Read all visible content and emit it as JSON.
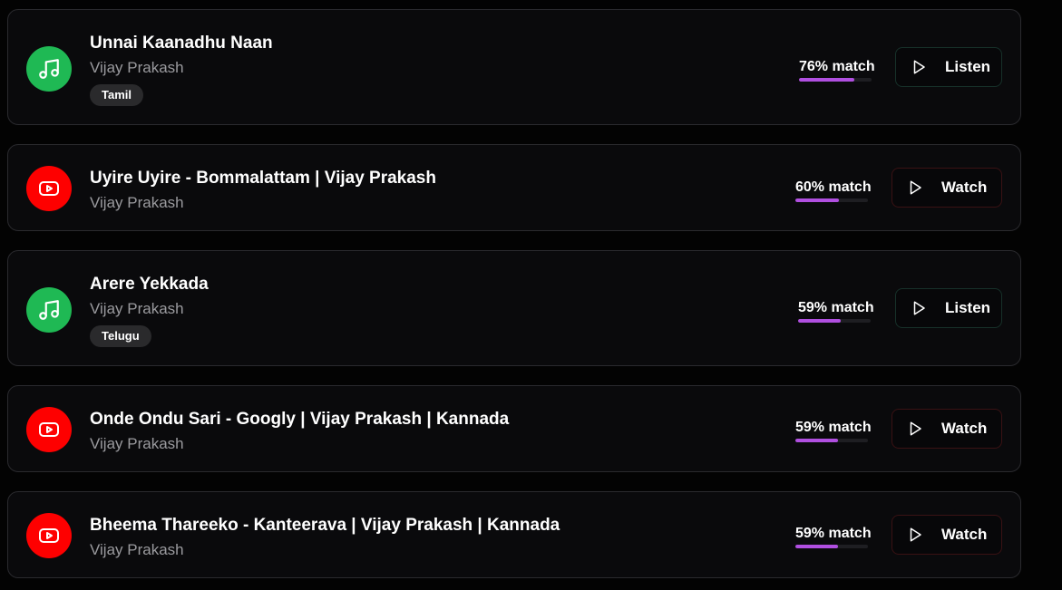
{
  "results": [
    {
      "title": "Unnai Kaanadhu Naan",
      "artist": "Vijay Prakash",
      "language": "Tamil",
      "source": "music",
      "source_icon": "music-note-icon",
      "match_label": "76% match",
      "match_fraction": 0.76,
      "action_label": "Listen"
    },
    {
      "title": "Uyire Uyire - Bommalattam | Vijay Prakash",
      "artist": "Vijay Prakash",
      "source": "youtube",
      "source_icon": "youtube-icon",
      "match_label": "60% match",
      "match_fraction": 0.6,
      "action_label": "Watch"
    },
    {
      "title": "Arere Yekkada",
      "artist": "Vijay Prakash",
      "language": "Telugu",
      "source": "music",
      "source_icon": "music-note-icon",
      "match_label": "59% match",
      "match_fraction": 0.59,
      "action_label": "Listen"
    },
    {
      "title": "Onde Ondu Sari - Googly | Vijay Prakash | Kannada",
      "artist": "Vijay Prakash",
      "source": "youtube",
      "source_icon": "youtube-icon",
      "match_label": "59% match",
      "match_fraction": 0.59,
      "action_label": "Watch"
    },
    {
      "title": "Bheema Thareeko - Kanteerava | Vijay Prakash | Kannada",
      "artist": "Vijay Prakash",
      "source": "youtube",
      "source_icon": "youtube-icon",
      "match_label": "59% match",
      "match_fraction": 0.59,
      "action_label": "Watch"
    }
  ],
  "colors": {
    "music_green": "#1fb954",
    "youtube_red": "#fe0000",
    "match_bar": "#b04fe0"
  }
}
